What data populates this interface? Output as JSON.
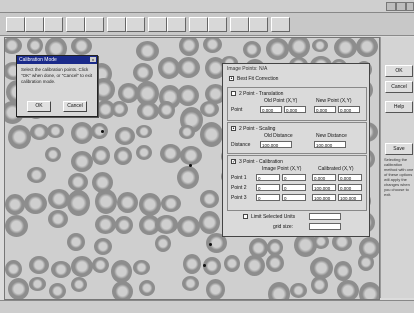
{
  "window": {
    "title": "",
    "status": ""
  },
  "toolbar": {
    "buttons": [
      "",
      "",
      "",
      "",
      "",
      "",
      "",
      "",
      "",
      "",
      "",
      "",
      "",
      ""
    ]
  },
  "dialog_small": {
    "title": "Calibration Mode",
    "message": "Select the calibration points. Click \"OK\" when done, or \"Cancel\" to exit calibration mode.",
    "ok": "OK",
    "cancel": "Cancel"
  },
  "dialog_main": {
    "image_points": "Image Points: N/A",
    "opt_no_correction": "Best Fit Correction",
    "opt_translation": "2 Point - Translation",
    "col_old": "Old Point (X,Y)",
    "col_new": "New Point (X,Y)",
    "point_label": "Point",
    "translation_values": [
      "0.000",
      "0.000",
      "0.000",
      "0.000"
    ],
    "opt_scaling": "2 Point - Scaling",
    "col_old_distance": "Old Distance",
    "col_new_distance": "New Distance",
    "distance_label": "Distance",
    "scaling_values": [
      "100.000",
      "100.000"
    ],
    "opt_calibration": "3 Point - Calibration",
    "col_image": "Image Point (X,Y)",
    "col_calibrated": "Calibrated (X,Y)",
    "calib_rows": [
      {
        "label": "Point 1",
        "img": [
          "0",
          "0"
        ],
        "cal": [
          "0.000",
          "0.000"
        ]
      },
      {
        "label": "Point 2",
        "img": [
          "0",
          "0"
        ],
        "cal": [
          "100.000",
          "0.000"
        ]
      },
      {
        "label": "Point 3",
        "img": [
          "0",
          "0"
        ],
        "cal": [
          "100.000",
          "100.000"
        ]
      }
    ],
    "opt_units": "Limit Selected Units",
    "grid_label": "grid size:"
  },
  "right_panel": {
    "ok": "OK",
    "cancel": "Cancel",
    "help": "Help",
    "save": "Save",
    "notes": "Selecting the calibration method with one of these options will apply the changes when you choose to exit."
  }
}
